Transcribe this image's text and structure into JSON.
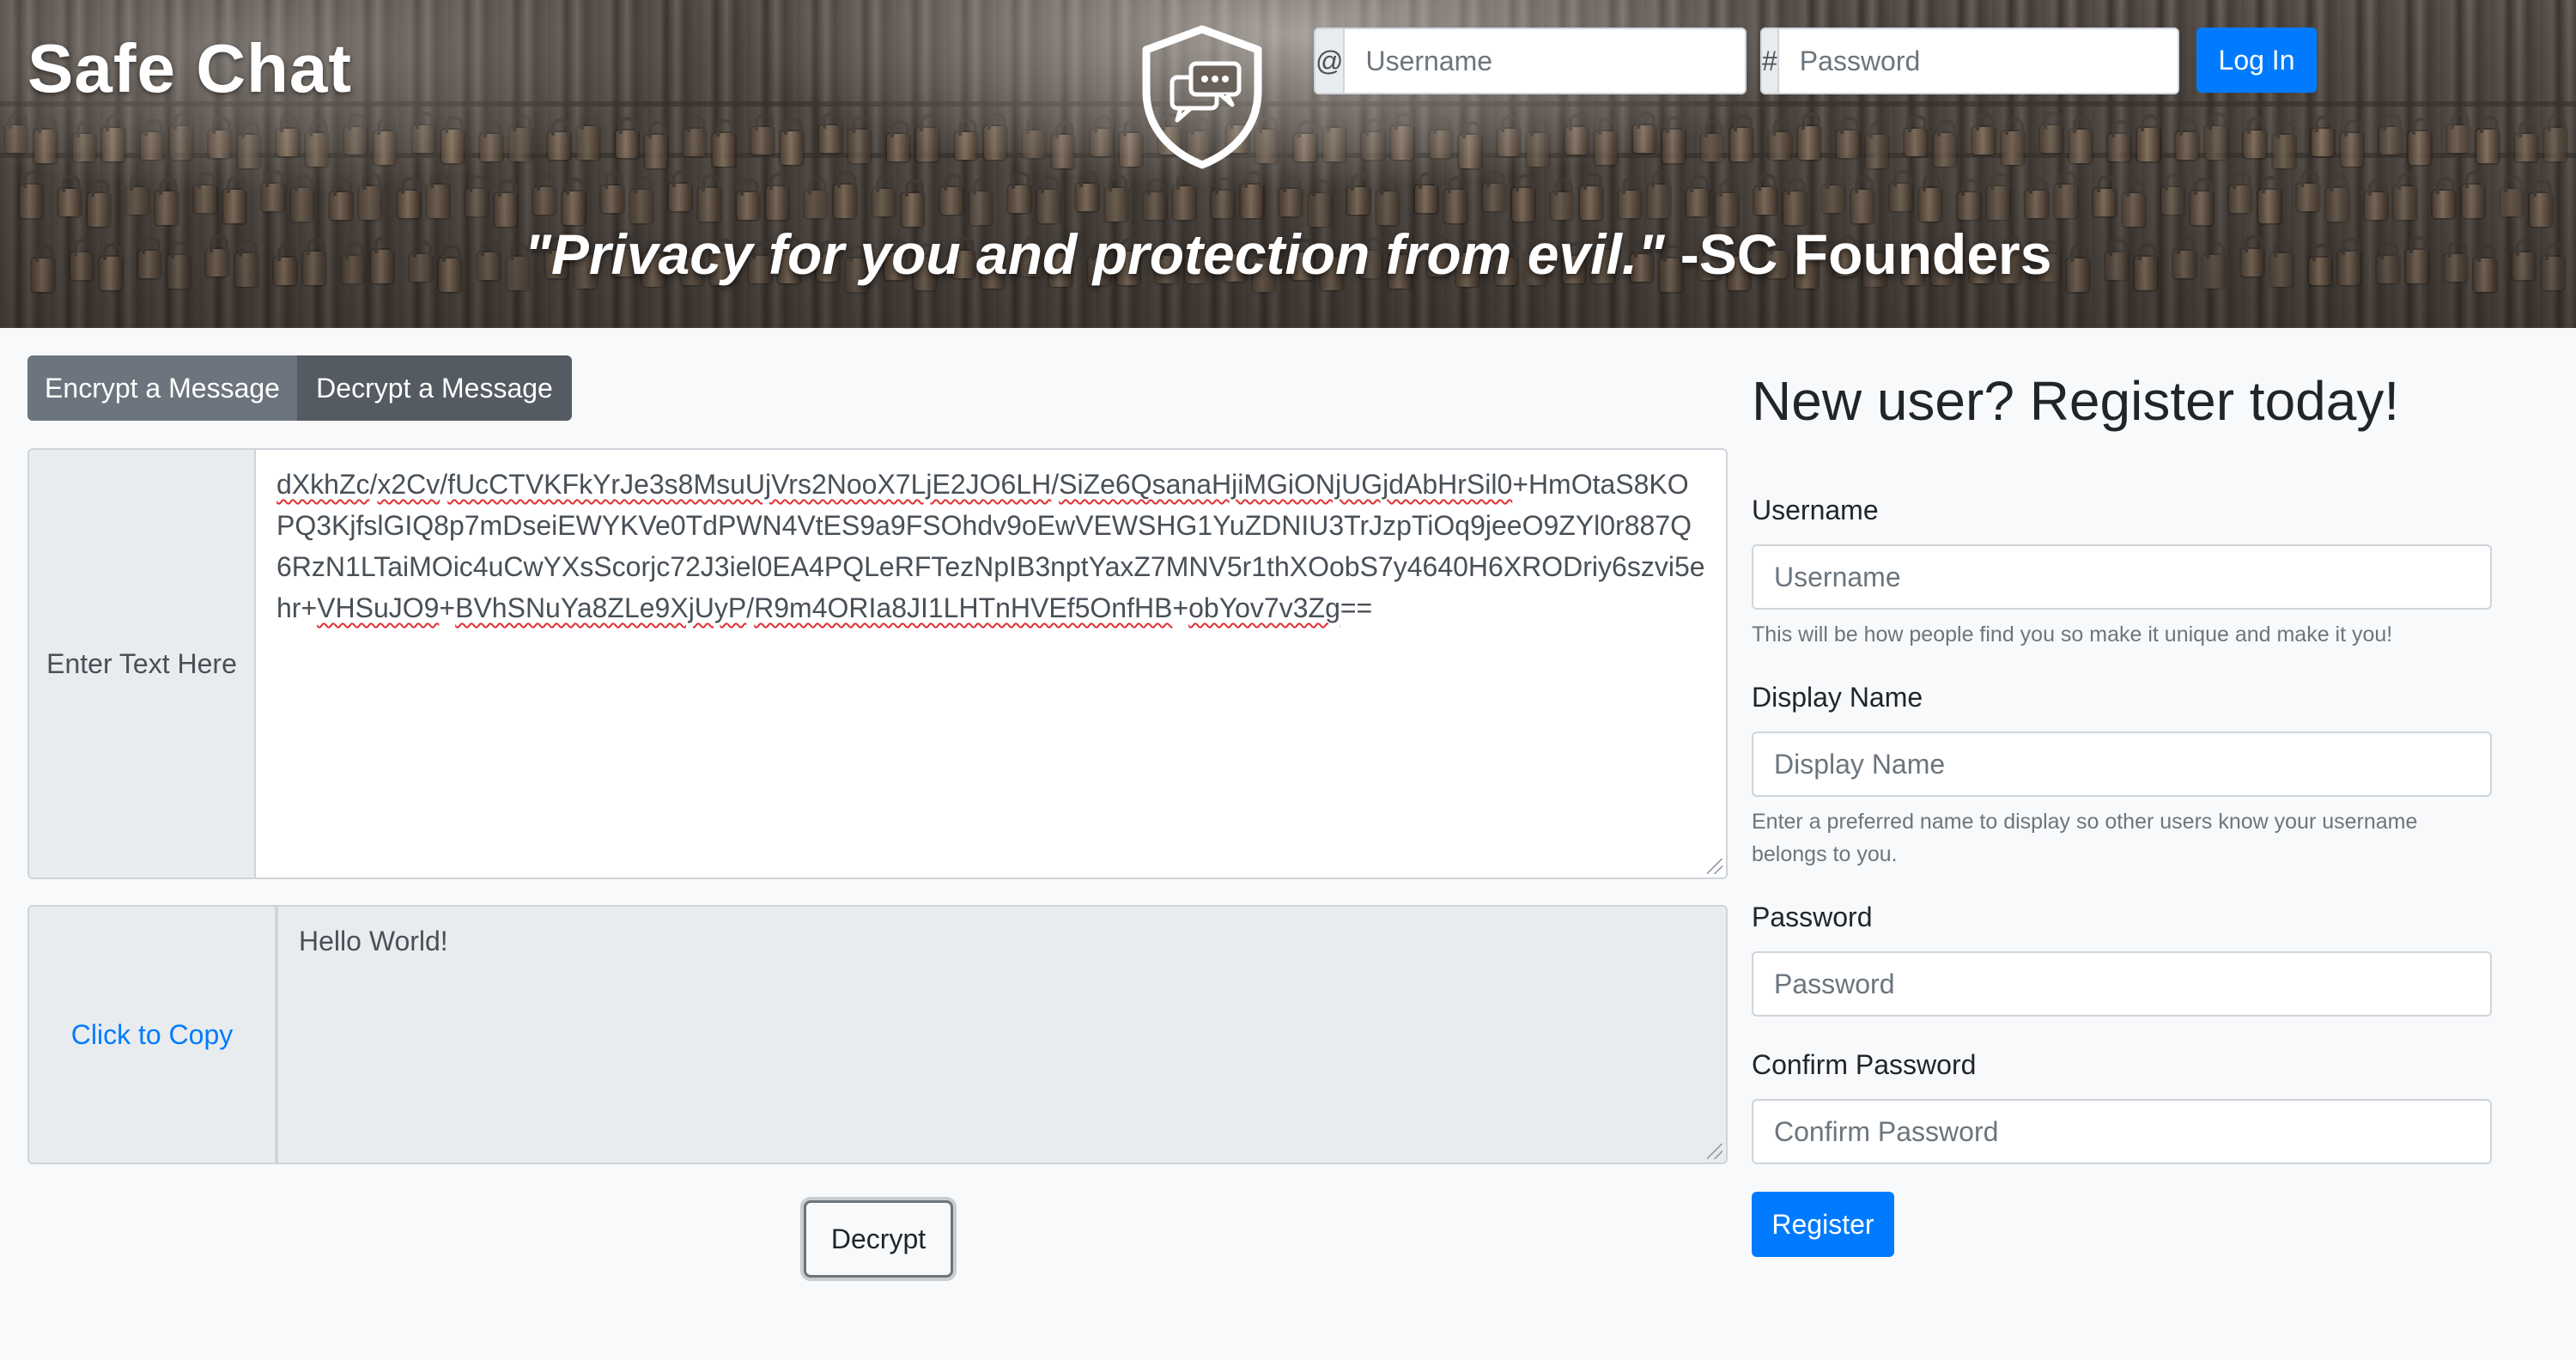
{
  "header": {
    "brand": "Safe Chat",
    "logo_icon": "shield-chat-icon",
    "quote_main": "\"Privacy for you and protection from evil.\"",
    "quote_author": " -SC Founders"
  },
  "login": {
    "username_addon": "@",
    "username_placeholder": "Username",
    "password_addon": "#",
    "password_placeholder": "Password",
    "login_label": "Log In"
  },
  "tabs": [
    {
      "label": "Encrypt a Message"
    },
    {
      "label": "Decrypt a Message",
      "active": true
    }
  ],
  "input_area": {
    "label": "Enter Text Here",
    "tokens": [
      {
        "t": "dXkhZc",
        "s": true
      },
      {
        "t": "/",
        "s": false
      },
      {
        "t": "x2Cv",
        "s": true
      },
      {
        "t": "/",
        "s": false
      },
      {
        "t": "fUcCTVKFkYrJe3s8MsuUjVrs2NooX7LjE2JO6LH",
        "s": true
      },
      {
        "t": "/",
        "s": false
      },
      {
        "t": "SiZe6QsanaHjiMGiONjUGjdAbHrSil0",
        "s": true
      },
      {
        "t": "+HmOtaS8KOPQ3KjfslGIQ8p7mDseiEWYKVe0TdPWN4VtES9a9FSOhdv9oEwVEWSHG1YuZDNIU3TrJzpTiOq9jeeO9ZYl0r887Q6RzN1LTaiMOic4uCwYXsScorjc72J3iel0EA4PQLeRFTezNpIB3nptYaxZ7MNV5r1thXOobS7y4640H6XRODriy6szvi5ehr+",
        "s": false
      },
      {
        "t": "VHSuJO9",
        "s": true
      },
      {
        "t": "+",
        "s": false
      },
      {
        "t": "BVhSNuYa8ZLe9XjUyP",
        "s": true
      },
      {
        "t": "/",
        "s": false
      },
      {
        "t": "R9m4ORIa8JI1LHTnHVEf5OnfHB",
        "s": true
      },
      {
        "t": "+",
        "s": false
      },
      {
        "t": "obYov7v3Zg",
        "s": true
      },
      {
        "t": "==",
        "s": false
      }
    ]
  },
  "output_area": {
    "label": "Click to Copy",
    "value": "Hello World!"
  },
  "decrypt_button": "Decrypt",
  "register": {
    "title": "New user? Register today!",
    "username_label": "Username",
    "username_placeholder": "Username",
    "username_help": "This will be how people find you so make it unique and make it you!",
    "display_label": "Display Name",
    "display_placeholder": "Display Name",
    "display_help": "Enter a preferred name to display so other users know your username belongs to you.",
    "password_label": "Password",
    "password_placeholder": "Password",
    "confirm_label": "Confirm Password",
    "confirm_placeholder": "Confirm Password",
    "register_label": "Register"
  },
  "colors": {
    "primary": "#007bff",
    "secondary": "#6c757d",
    "secondary_active": "#545b62",
    "background": "#f8f9fa",
    "addon": "#e9ecef",
    "spell_underline": "#e03030"
  }
}
